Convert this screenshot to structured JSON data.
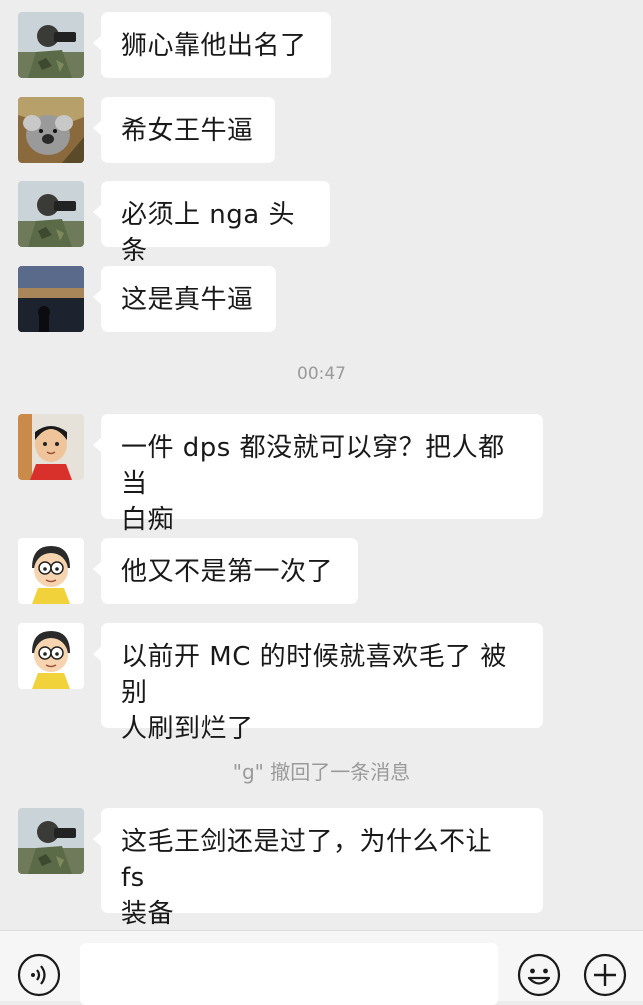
{
  "messages": [
    {
      "text": "狮心靠他出名了",
      "avatar": "soldier-camera-avatar"
    },
    {
      "text": "希女王牛逼",
      "avatar": "koala-avatar"
    },
    {
      "text": "必须上 nga 头条",
      "avatar": "soldier-camera-avatar"
    },
    {
      "text": "这是真牛逼",
      "avatar": "sunset-avatar"
    },
    {
      "text": "一件 dps 都没就可以穿？把人都当",
      "text2": "白痴",
      "avatar": "child-avatar"
    },
    {
      "text": "他又不是第一次了",
      "avatar": "nobita-avatar"
    },
    {
      "text": "以前开 MC 的时候就喜欢毛了 被别",
      "text2": "人刷到烂了",
      "avatar": "nobita-avatar"
    },
    {
      "text": "这毛王剑还是过了，为什么不让 fs",
      "text2": "装备",
      "avatar": "soldier-camera-avatar"
    }
  ],
  "timestamp": "00:47",
  "recall_notice": "\"g\" 撤回了一条消息",
  "colors": {
    "background": "#ededed",
    "bubble": "#ffffff",
    "meta_text": "#9a9a9a",
    "input_bar": "#f6f6f6"
  },
  "input_bar": {
    "icons": [
      "voice-icon",
      "emoji-icon",
      "plus-icon"
    ],
    "text_value": ""
  }
}
